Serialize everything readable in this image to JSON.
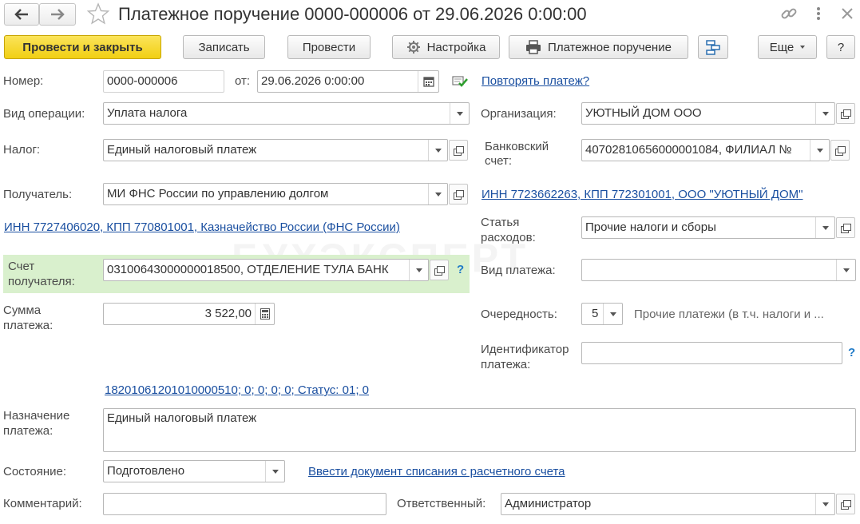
{
  "window": {
    "title": "Платежное поручение 0000-000006 от 29.06.2026 0:00:00",
    "watermark": "БУХЭКСПЕРТ"
  },
  "toolbar": {
    "post_close": "Провести и закрыть",
    "save": "Записать",
    "post": "Провести",
    "settings": "Настройка",
    "print_order": "Платежное поручение",
    "more": "Еще",
    "help": "?"
  },
  "form": {
    "number_label": "Номер:",
    "number_value": "0000-000006",
    "date_label": "от:",
    "date_value": "29.06.2026  0:00:00",
    "repeat_link": "Повторять платеж?",
    "operation_label": "Вид операции:",
    "operation_value": "Уплата налога",
    "organization_label": "Организация:",
    "organization_value": "УЮТНЫЙ ДОМ ООО",
    "tax_label": "Налог:",
    "tax_value": "Единый налоговый платеж",
    "bank_account_label_1": "Банковский",
    "bank_account_label_2": "счет:",
    "bank_account_value": "40702810656000001084, ФИЛИАЛ №",
    "recipient_label": "Получатель:",
    "recipient_value": "МИ ФНС России по управлению долгом",
    "org_inn_link": "ИНН 7723662263, КПП 772301001, ООО \"УЮТНЫЙ ДОМ\"",
    "recipient_inn_link": "ИНН 7727406020, КПП 770801001, Казначейство России (ФНС России)",
    "expense_label_1": "Статья",
    "expense_label_2": "расходов:",
    "expense_value": "Прочие налоги и сборы",
    "recipient_account_label_1": "Счет",
    "recipient_account_label_2": "получателя:",
    "recipient_account_value": "03100643000000018500, ОТДЕЛЕНИЕ ТУЛА БАНК",
    "payment_type_label": "Вид платежа:",
    "payment_type_value": "",
    "amount_label_1": "Сумма",
    "amount_label_2": "платежа:",
    "amount_value": "3 522,00",
    "priority_label": "Очередность:",
    "priority_value": "5",
    "priority_text": "Прочие платежи (в т.ч. налоги и ...",
    "identifier_label_1": "Идентификатор",
    "identifier_label_2": "платежа:",
    "identifier_value": "",
    "kbk_link": "18201061201010000510; 0; 0; 0; 0; Статус: 01; 0",
    "purpose_label_1": "Назначение",
    "purpose_label_2": "платежа:",
    "purpose_value": "Единый налоговый платеж",
    "status_label": "Состояние:",
    "status_value": "Подготовлено",
    "writeoff_link": "Ввести документ списания с расчетного счета",
    "comment_label": "Комментарий:",
    "comment_value": "",
    "responsible_label": "Ответственный:",
    "responsible_value": "Администратор"
  },
  "colors": {
    "primary_button": "#f1cf13",
    "link": "#1a4fa0",
    "highlight_panel": "#d9f0cd",
    "help_icon": "#1f7ac7"
  }
}
